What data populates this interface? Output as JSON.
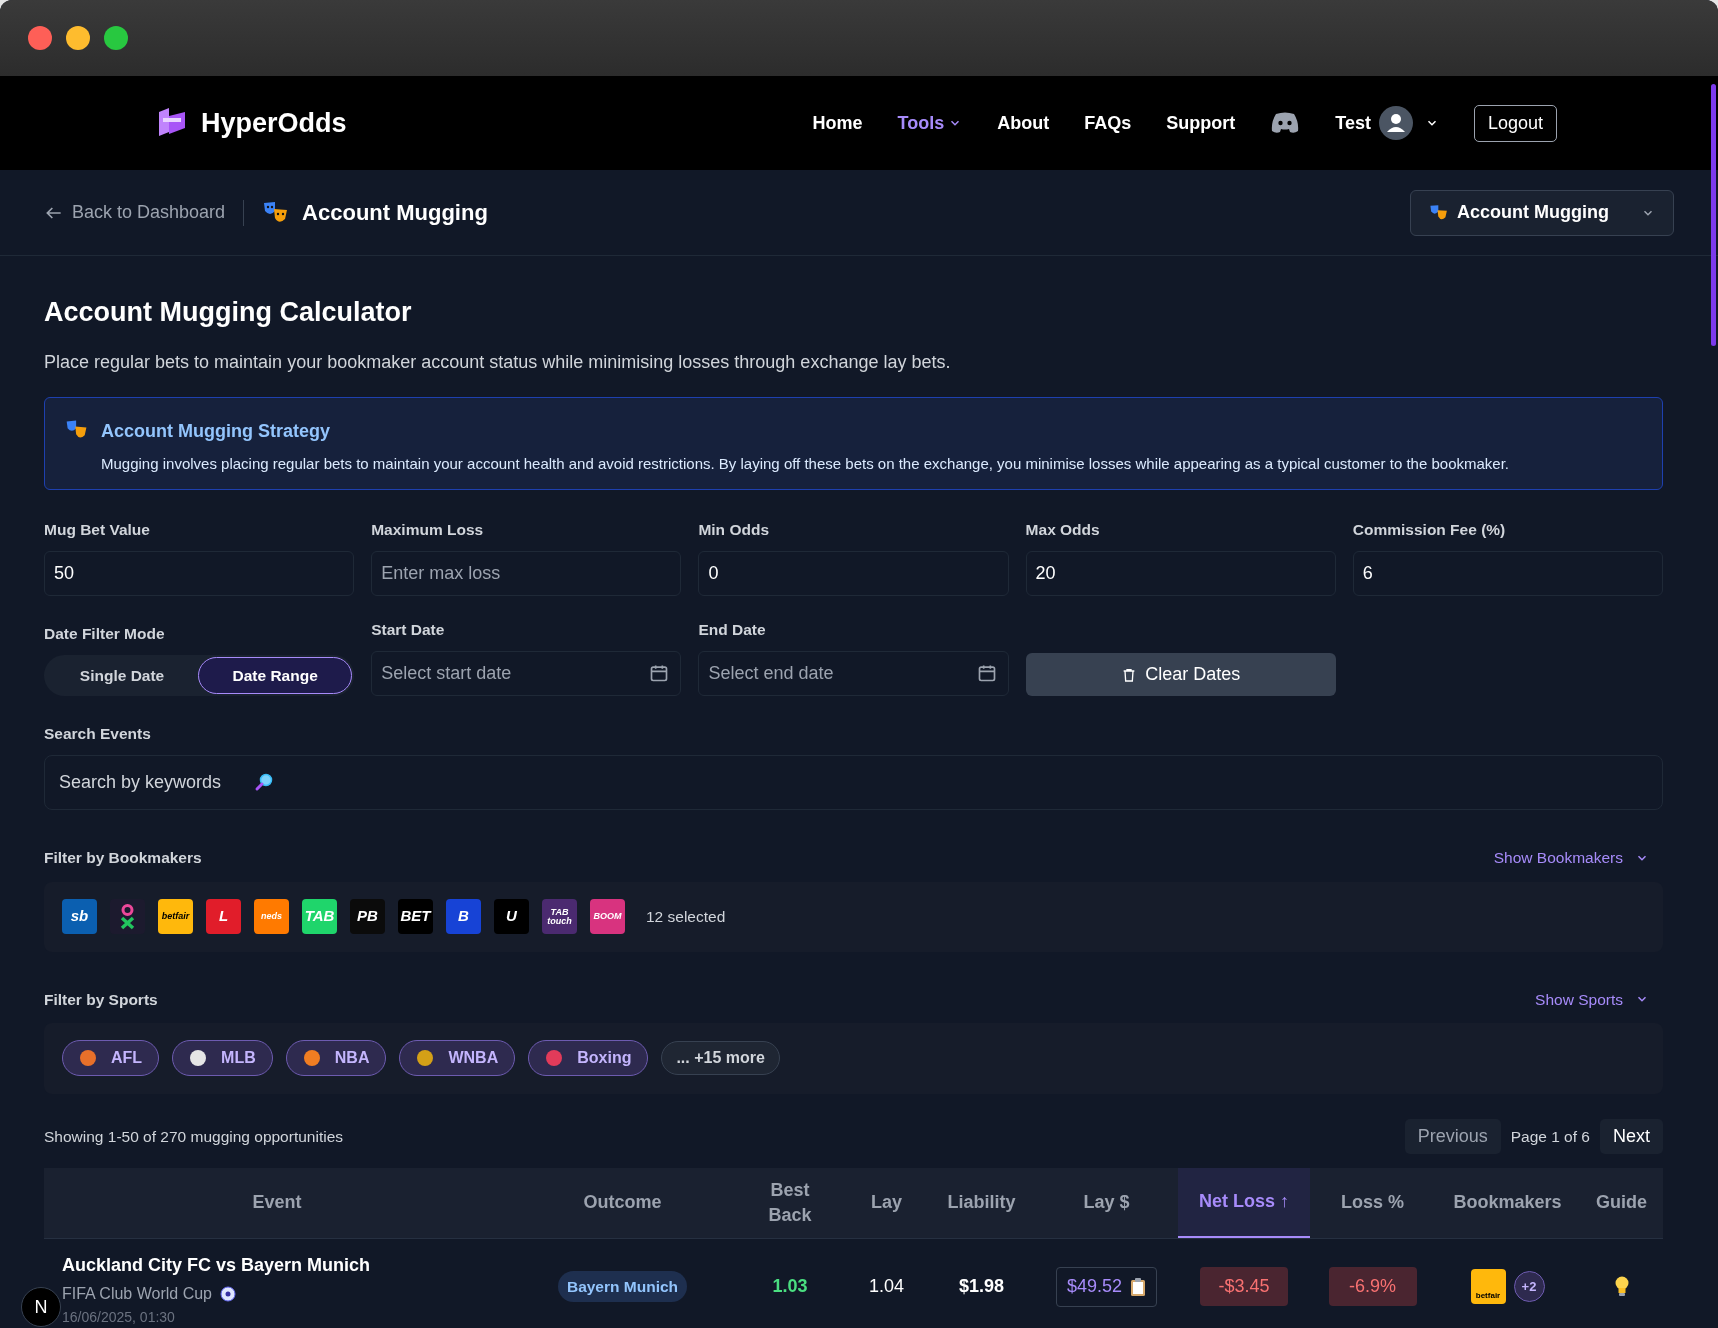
{
  "brand": "HyperOdds",
  "nav": [
    {
      "label": "Home",
      "selected": false,
      "dropdown": false
    },
    {
      "label": "Tools",
      "selected": true,
      "dropdown": true
    },
    {
      "label": "About",
      "selected": false,
      "dropdown": false
    },
    {
      "label": "FAQs",
      "selected": false,
      "dropdown": false
    },
    {
      "label": "Support",
      "selected": false,
      "dropdown": false
    }
  ],
  "user": {
    "name": "Test",
    "logout": "Logout"
  },
  "subheader": {
    "back": "Back to Dashboard",
    "title": "Account Mugging",
    "tool_select": "Account Mugging"
  },
  "page": {
    "title": "Account Mugging Calculator",
    "description": "Place regular bets to maintain your bookmaker account status while minimising losses through exchange lay bets."
  },
  "info": {
    "title": "Account Mugging Strategy",
    "text": "Mugging involves placing regular bets to maintain your account health and avoid restrictions. By laying off these bets on the exchange, you minimise losses while appearing as a typical customer to the bookmaker."
  },
  "fields": [
    {
      "label": "Mug Bet Value",
      "value": "50"
    },
    {
      "label": "Maximum Loss",
      "placeholder": "Enter max loss"
    },
    {
      "label": "Min Odds",
      "value": "0"
    },
    {
      "label": "Max Odds",
      "value": "20"
    },
    {
      "label": "Commission Fee (%)",
      "value": "6"
    }
  ],
  "date_filter": {
    "label": "Date Filter Mode",
    "modes": [
      {
        "label": "Single Date",
        "selected": false
      },
      {
        "label": "Date Range",
        "selected": true
      }
    ],
    "start": {
      "label": "Start Date",
      "placeholder": "Select start date"
    },
    "end": {
      "label": "End Date",
      "placeholder": "Select end date"
    },
    "clear": "Clear Dates"
  },
  "search": {
    "label": "Search Events",
    "placeholder": "Search by keywords"
  },
  "bookmakers": {
    "label": "Filter by Bookmakers",
    "toggle": "Show Bookmakers",
    "count": "12 selected",
    "items": [
      {
        "kind": "text",
        "label": "sb",
        "color": "#0b5fb0"
      },
      {
        "kind": "mark",
        "color": "#1c1a2e"
      },
      {
        "kind": "text",
        "label": "betfair",
        "color": "#ffb80c"
      },
      {
        "kind": "text",
        "label": "L",
        "color": "#e11d2a"
      },
      {
        "kind": "text",
        "label": "neds",
        "color": "#ff7a00"
      },
      {
        "kind": "text",
        "label": "TAB",
        "color": "#1fd56b"
      },
      {
        "kind": "text",
        "label": "PB",
        "color": "#0b0b0b"
      },
      {
        "kind": "text",
        "label": "BET",
        "color": "#000000"
      },
      {
        "kind": "text",
        "label": "B",
        "color": "#1743d6"
      },
      {
        "kind": "text",
        "label": "U",
        "color": "#000000"
      },
      {
        "kind": "text",
        "label": "TAB touch",
        "color": "#4b2a70"
      },
      {
        "kind": "text",
        "label": "BOOM",
        "color": "#d8337f"
      }
    ]
  },
  "sports": {
    "label": "Filter by Sports",
    "toggle": "Show Sports",
    "items": [
      {
        "label": "AFL",
        "color": "#e8702a"
      },
      {
        "label": "MLB",
        "color": "#e5e5e5"
      },
      {
        "label": "NBA",
        "color": "#f07d22"
      },
      {
        "label": "WNBA",
        "color": "#d4a017"
      },
      {
        "label": "Boxing",
        "color": "#e23b5a"
      }
    ],
    "more": "... +15 more"
  },
  "results": {
    "summary": "Showing 1-50 of 270 mugging opportunities",
    "previous": "Previous",
    "page": "Page 1 of 6",
    "next": "Next"
  },
  "table": {
    "columns": [
      {
        "label": "Event",
        "selected": false
      },
      {
        "label": "Outcome",
        "selected": false
      },
      {
        "label": "Best Back",
        "selected": false
      },
      {
        "label": "Lay",
        "selected": false
      },
      {
        "label": "Liability",
        "selected": false
      },
      {
        "label": "Lay $",
        "selected": false
      },
      {
        "label": "Net Loss ↑",
        "selected": true
      },
      {
        "label": "Loss %",
        "selected": false
      },
      {
        "label": "Bookmakers",
        "selected": false
      },
      {
        "label": "Guide",
        "selected": false
      }
    ],
    "rows": [
      {
        "event": "Auckland City FC vs Bayern Munich",
        "competition": "FIFA Club World Cup",
        "time": "16/06/2025, 01:30",
        "outcome": "Bayern Munich",
        "best_back": "1.03",
        "lay": "1.04",
        "liability": "$1.98",
        "lay_stake": "$49.52",
        "net_loss": "-$3.45",
        "loss_pct": "-6.9%",
        "bookmaker": "betfair",
        "more_bookmakers": "+2"
      }
    ]
  },
  "dev_badge": "N"
}
